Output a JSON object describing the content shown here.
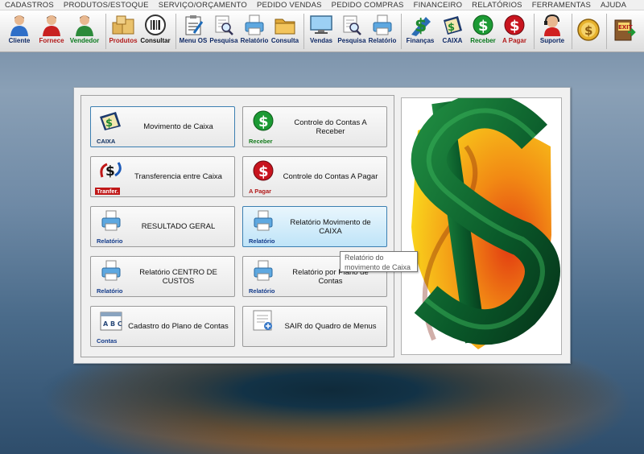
{
  "menubar": {
    "items": [
      "CADASTROS",
      "PRODUTOS/ESTOQUE",
      "SERVIÇO/ORÇAMENTO",
      "PEDIDO VENDAS",
      "PEDIDO COMPRAS",
      "FINANCEIRO",
      "RELATÓRIOS",
      "FERRAMENTAS",
      "AJUDA"
    ]
  },
  "toolbar": {
    "cliente": "Cliente",
    "fornece": "Fornece",
    "vendedor": "Vendedor",
    "produtos": "Produtos",
    "consultar": "Consultar",
    "menu_os": "Menu OS",
    "pesquisa1": "Pesquisa",
    "relatorio1": "Relatório",
    "consulta": "Consulta",
    "vendas": "Vendas",
    "pesquisa2": "Pesquisa",
    "relatorio2": "Relatório",
    "financas": "Finanças",
    "caixa": "CAIXA",
    "receber": "Receber",
    "a_pagar": "A Pagar",
    "suporte": "Suporte"
  },
  "panel": {
    "buttons": [
      {
        "label": "Movimento de Caixa",
        "caption": "CAIXA"
      },
      {
        "label": "Controle do Contas A Receber",
        "caption": "Receber"
      },
      {
        "label": "Transferencia entre Caixa",
        "caption": "Tranfer."
      },
      {
        "label": "Controle do Contas A Pagar",
        "caption": "A Pagar"
      },
      {
        "label": "RESULTADO GERAL",
        "caption": "Relatório"
      },
      {
        "label": "Relatório Movimento de CAIXA",
        "caption": "Relatório"
      },
      {
        "label": "Relatório CENTRO DE CUSTOS",
        "caption": "Relatório"
      },
      {
        "label": "Relatório por Plano de Contas",
        "caption": "Relatório"
      },
      {
        "label": "Cadastro do Plano de Contas",
        "caption": "Contas"
      },
      {
        "label": "SAIR do Quadro de Menus",
        "caption": ""
      }
    ]
  },
  "tooltip": {
    "text": "Relatório do movimento de Caixa"
  },
  "colors": {
    "accent_blue": "#3c7fb1",
    "money_green": "#0a8a2a",
    "money_red": "#c0141c"
  },
  "icons": [
    "person-icon",
    "boxes-icon",
    "barcode-icon",
    "clipboard-icon",
    "search-icon",
    "printer-icon",
    "folder-icon",
    "monitor-icon",
    "dollar-icon",
    "book-icon",
    "support-icon",
    "coin-icon",
    "exit-icon",
    "calendar-icon",
    "document-icon"
  ]
}
